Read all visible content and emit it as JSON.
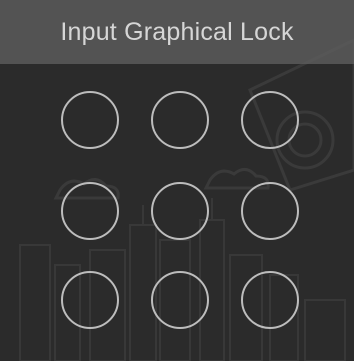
{
  "header": {
    "title": "Input Graphical Lock"
  },
  "pattern_grid": {
    "rows": 3,
    "cols": 3,
    "dot_color": "#bdbdbd"
  },
  "colors": {
    "background": "#2b2b2b",
    "header_background": "#5f5f5f",
    "title_text": "#d6d6d6"
  }
}
